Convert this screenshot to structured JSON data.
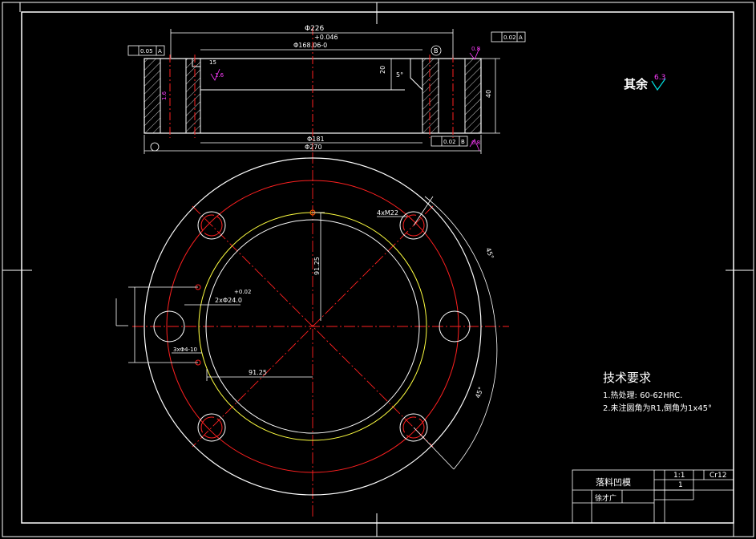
{
  "drawing": {
    "roughness_label": "其余",
    "roughness_value": "6.3",
    "technical_requirements": {
      "title": "技术要求",
      "items": [
        "1.热处理: 60-62HRC.",
        "2.未注圆角为R1,倒角为1x45°"
      ]
    },
    "title_block": {
      "part_name": "落料凹模",
      "scale": "1:1",
      "material": "Cr12",
      "quantity": "1",
      "designer_label": "徐才广"
    },
    "section_view": {
      "top_dim": "Φ226",
      "inner_tol": "+0.046",
      "inner_dim": "Φ168.06-0",
      "bottom_inner_dim": "Φ181",
      "bottom_outer_dim": "Φ270",
      "height_dim": "40",
      "step_dim": "20",
      "chamfer_dim": "5°",
      "flatness_tol": "0.05",
      "flatness_datum": "A",
      "parallel_tol": "0.02",
      "parallel_datum": "A",
      "position_tol": "0.02",
      "position_datum": "B",
      "datum_b": "B",
      "roughness_left": "1.6",
      "roughness_hole": "1.6",
      "roughness_right": "0.8",
      "roughness_bottom": "0.8",
      "depth_mark": "15"
    },
    "plan_view": {
      "thread_label": "4xM22",
      "pin_label": "2xΦ24.0",
      "pin_tol": "+0.02",
      "hole_label": "3xΦ4-10",
      "radial_dim": "91.25",
      "horizontal_dim": "91.25",
      "angle_top": "45°",
      "angle_bottom": "45°"
    }
  }
}
